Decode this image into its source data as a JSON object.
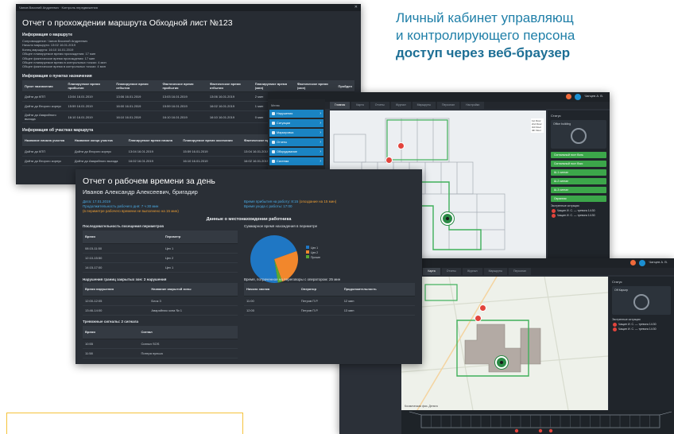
{
  "heading": {
    "line1": "Личный кабинет управляющ",
    "line2": "и контролирующего персона",
    "line3": "доступ через веб-браузер"
  },
  "route_report": {
    "window_title": "Чанов Василий Андреевич · Контроль передвижения",
    "title": "Отчет о прохождении маршрута Обходной лист №123",
    "sec_route": "Информация о маршруте",
    "route_lines": [
      "Сопровождение: Чанов Василий Андреевич",
      "Начало маршрута: 13:02 16.01.2019",
      "Конец маршрута: 16:10 16.01.2019",
      "Общее планируемое время прохождения: 17 мин",
      "Общее фактическое время прохождения: 17 мин",
      "Общее планируемое время в контрольных точках: 4 мин",
      "Общее фактическое время в контрольных точках: 4 мин"
    ],
    "sec_points": "Информация о пунктах назначения",
    "points_headers": [
      "Пункт назначения",
      "Планируемое время прибытия",
      "Планируемое время отбытия",
      "Фактическое время прибытия",
      "Фактическое время отбытия",
      "Планируемое время (мин)",
      "Фактическое время (мин)",
      "Пройден"
    ],
    "points_rows": [
      [
        "Дойти до КПП",
        "13:04 16.01.2019",
        "13:06 16.01.2019",
        "13:03 16.01.2019",
        "13:06 16.01.2019",
        "2 мин",
        "3 мин",
        ""
      ],
      [
        "Дойти до Второго корпус",
        "15:59 16.01.2019",
        "16:00 16.01.2019",
        "15:59 16.01.2019",
        "16:02 16.01.2019",
        "1 мин",
        "3 мин",
        ""
      ],
      [
        "Дойти до Аварийного выхода",
        "16:10 16.01.2019",
        "16:10 16.01.2019",
        "16:10 16.01.2019",
        "16:10 16.01.2019",
        "0 мин",
        "0 мин",
        ""
      ]
    ],
    "sec_segments": "Информация об участках маршрута",
    "segments_headers": [
      "Название начала участка",
      "Название конца участка",
      "Планируемое время начала",
      "Планируемое время окончания",
      "Фактическое время начала",
      "Фактическое время окончания"
    ],
    "segments_rows": [
      [
        "Дойти до КПП",
        "Дойти до Второго корпус",
        "13:04 16.01.2019",
        "15:59 16.01.2019",
        "13:04 16.01.2019",
        "15:59 16.01.2019"
      ],
      [
        "Дойти до Второго корпус",
        "Дойти до Аварийного выхода",
        "16:02 16.01.2019",
        "16:10 16.01.2019",
        "16:02 16.01.2019",
        "16:10 16.01.2019"
      ]
    ]
  },
  "map_top": {
    "user": "Чанцев А. В.",
    "tabs": [
      "Главная",
      "Карта",
      "Отчеты",
      "Журнал",
      "Маршруты",
      "Персонал",
      "Настройки"
    ],
    "menu_title": "Меню",
    "menu_items": [
      "Нарушения",
      "Ситуации",
      "Маркировка",
      "Отчеты",
      "Оборудование",
      "Система"
    ],
    "zoom_labels": [
      "1st Floor",
      "2nd Floor",
      "3rd Floor",
      "4th Floor"
    ],
    "panel_title": "Статус",
    "card_title": "Office building",
    "buttons": [
      "Сигнальный пост боль",
      "Сигнальный пост бокс",
      "Ш-1 сигнал",
      "Ш-2 сигнал",
      "Ш-3 сигнал",
      "Охранник"
    ],
    "alarms_title": "Экстренные ситуации",
    "alarms": [
      "Чащин И. С. — тревога 14:30",
      "Чащин И. С. — тревога 14:30"
    ]
  },
  "work_report": {
    "title": "Отчет о рабочем времени за день",
    "person": "Иванов Александр Алексеевич, бригадир",
    "date_label": "Дата: 17.01.2019",
    "duration_label": "Продолжительность рабочего дня: 7 ч 30 мин",
    "duration_note": "(в периметре рабочего времени не выполнено на 15 мин)",
    "arrive_label": "Время прибытия на работу: 8:15",
    "arrive_note": "(опоздание на 15 мин)",
    "leave_label": "Время ухода с работы: 17:00",
    "section": "Данные о местонахождении работника",
    "visits_title": "Последовательность посещения периметров",
    "visits_headers": [
      "Время",
      "Периметр"
    ],
    "visits_rows": [
      [
        "08:15-11:50",
        "Цех 1"
      ],
      [
        "12:10-15:50",
        "Цех 2"
      ],
      [
        "14:15-17:00",
        "Цех 1"
      ]
    ],
    "pie_title": "Суммарное время нахождения в периметре",
    "legend": [
      "Цех 1",
      "Цех 2",
      "Прочие"
    ],
    "violations_title": "Нарушения границ закрытых зон: 2 нарушения",
    "violations_headers": [
      "Время нарушения",
      "Название закрытой зоны"
    ],
    "violations_rows": [
      [
        "12:00-12:05",
        "Блок 3"
      ],
      [
        "13:46-14:00",
        "Аварийная зона № 1"
      ]
    ],
    "calls_title": "Время, потраченное на переговоры с оператором: 25 мин",
    "calls_headers": [
      "Начало звонка",
      "Оператор",
      "Продолжительность"
    ],
    "calls_rows": [
      [
        "11:00",
        "Петров П.Р.",
        "12 мин"
      ],
      [
        "12:00",
        "Петров П.Р.",
        "13 мин"
      ]
    ],
    "alarms_title": "Тревожные сигналы: 2 сигнала",
    "alarms_headers": [
      "Время",
      "Сигнал"
    ],
    "alarms_rows": [
      [
        "10:55",
        "Сигнал SOS"
      ],
      [
        "11:58",
        "Потеря пульса"
      ]
    ]
  },
  "map_bottom": {
    "user": "Чанцев А. В.",
    "tabs": [
      "Главная",
      "Карта",
      "Отчеты",
      "Журнал",
      "Маршруты",
      "Персонал"
    ],
    "panel_title": "Статус",
    "card_title": "Off Карьер",
    "alarms_title": "Экстренные ситуации",
    "alarms": [
      "Чащин И. С. — тревога 14:30",
      "Чащин И. С. — тревога 14:30"
    ],
    "map_label": "Космическая фаз. Дельта"
  },
  "chart_data": {
    "type": "pie",
    "title": "Суммарное время нахождения в периметре",
    "categories": [
      "Цех 1",
      "Цех 2",
      "Прочие"
    ],
    "values": [
      72,
      25,
      3
    ],
    "colors": [
      "#1f77c4",
      "#f2872c",
      "#58a832"
    ]
  }
}
